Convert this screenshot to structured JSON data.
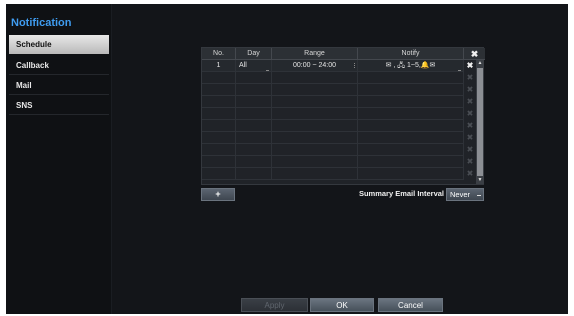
{
  "sidebar": {
    "title": "Notification",
    "items": [
      {
        "label": "Schedule",
        "active": true
      },
      {
        "label": "Callback",
        "active": false
      },
      {
        "label": "Mail",
        "active": false
      },
      {
        "label": "SNS",
        "active": false
      }
    ]
  },
  "table": {
    "headers": {
      "no": "No.",
      "day": "Day",
      "range": "Range",
      "notify": "Notify"
    },
    "delete_all_icon": "close-icon",
    "rows": [
      {
        "no": "1",
        "day": "All",
        "range": "00:00 ~ 24:00",
        "notify": "✉ , 🖧 1~5,🔔✉"
      }
    ],
    "delete_glyph": "✖"
  },
  "add_button": {
    "label": "+"
  },
  "summary": {
    "label": "Summary Email Interval",
    "value": "Never"
  },
  "footer": {
    "apply": "Apply",
    "ok": "OK",
    "cancel": "Cancel"
  },
  "colors": {
    "accent": "#3f9cf0",
    "background": "#131519"
  }
}
